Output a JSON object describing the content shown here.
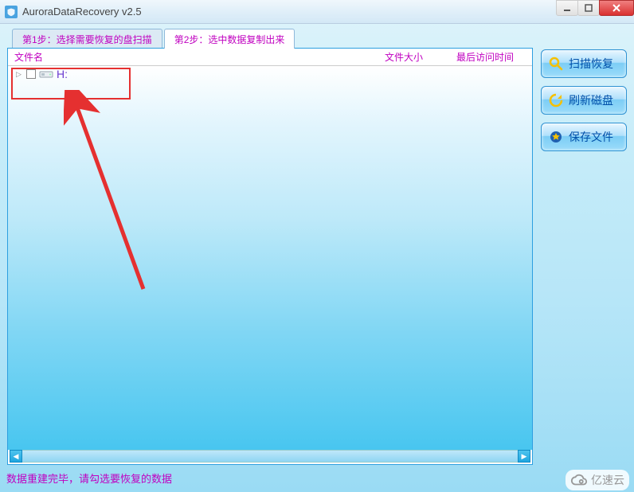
{
  "window": {
    "title": "AuroraDataRecovery v2.5"
  },
  "tabs": [
    {
      "label": "第1步：选择需要恢复的盘扫描",
      "active": false
    },
    {
      "label": "第2步：选中数据复制出来",
      "active": true
    }
  ],
  "columns": {
    "name": "文件名",
    "size": "文件大小",
    "time": "最后访问时间"
  },
  "tree": {
    "items": [
      {
        "label": "H:"
      }
    ]
  },
  "side_buttons": {
    "scan": "扫描恢复",
    "refresh": "刷新磁盘",
    "save": "保存文件"
  },
  "status": "数据重建完毕，请勾选要恢复的数据",
  "watermark": "亿速云",
  "icons": {
    "app": "app-icon",
    "drive": "drive-icon",
    "scan": "magnifier-icon",
    "refresh": "refresh-icon",
    "save": "star-folder-icon",
    "min": "minimize-icon",
    "max": "maximize-icon",
    "close": "close-icon"
  }
}
